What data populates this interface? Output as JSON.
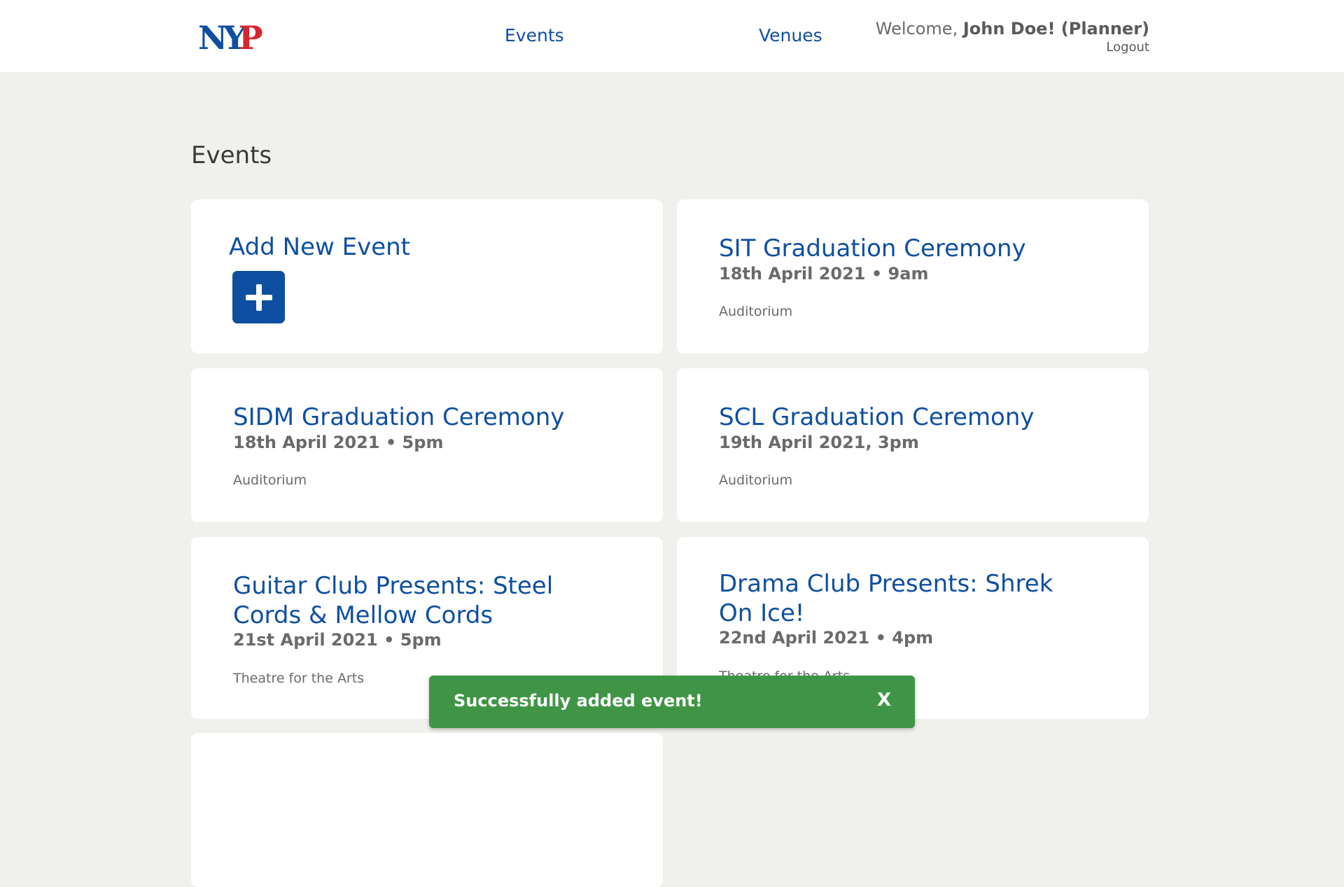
{
  "header": {
    "logo_text": "NYP",
    "nav": {
      "events": "Events",
      "venues": "Venues"
    },
    "welcome_prefix": "Welcome, ",
    "user_name": "John Doe! (Planner)",
    "logout": "Logout"
  },
  "page": {
    "title": "Events"
  },
  "add_card": {
    "title": "Add New Event",
    "icon": "plus-icon"
  },
  "events": [
    {
      "title": "SIT Graduation Ceremony",
      "date": "18th April 2021 • 9am",
      "venue": "Auditorium"
    },
    {
      "title": "SIDM Graduation Ceremony",
      "date": "18th April 2021 • 5pm",
      "venue": "Auditorium"
    },
    {
      "title": "SCL Graduation Ceremony",
      "date": "19th April 2021, 3pm",
      "venue": "Auditorium"
    },
    {
      "title": "Guitar Club Presents: Steel Cords & Mellow Cords",
      "date": "21st April 2021 • 5pm",
      "venue": "Theatre for the Arts"
    },
    {
      "title": "Drama Club Presents: Shrek On Ice!",
      "date": "22nd April 2021 • 4pm",
      "venue": "Theatre for the Arts"
    }
  ],
  "toast": {
    "message": "Successfully added event!",
    "close": "X"
  },
  "colors": {
    "brand_blue": "#0e4fa1",
    "brand_red": "#d7262e",
    "success_green": "#3f9545",
    "background": "#f0f0ec"
  }
}
